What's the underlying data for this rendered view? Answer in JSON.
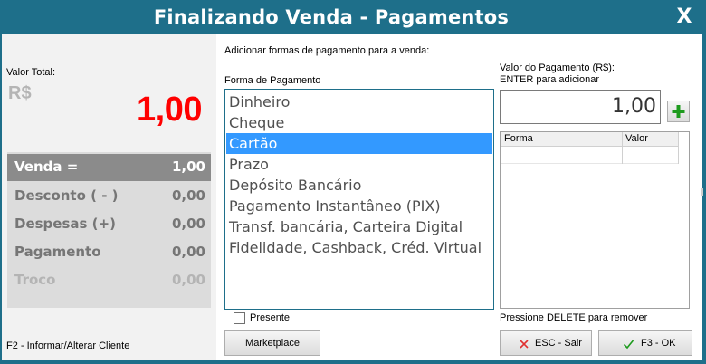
{
  "window": {
    "title": "Finalizando Venda - Pagamentos",
    "close_label": "X"
  },
  "left": {
    "valor_total_label": "Valor Total:",
    "currency": "R$",
    "total_value": "1,00",
    "summary": [
      {
        "label": "Venda =",
        "value": "1,00"
      },
      {
        "label": "Desconto ( - )",
        "value": "0,00"
      },
      {
        "label": "Despesas (+)",
        "value": "0,00"
      },
      {
        "label": "Pagamento",
        "value": "0,00"
      },
      {
        "label": "Troco",
        "value": "0,00"
      }
    ],
    "footer_hint": "F2 - Informar/Alterar Cliente"
  },
  "middle": {
    "header": "Adicionar formas de pagamento para a venda:",
    "list_label": "Forma de Pagamento",
    "payment_methods": [
      "Dinheiro",
      "Cheque",
      "Cartão",
      "Prazo",
      "Depósito Bancário",
      "Pagamento Instantâneo (PIX)",
      "Transf. bancária, Carteira Digital",
      "Fidelidade, Cashback, Créd. Virtual"
    ],
    "selected_index": 2,
    "presente_label": "Presente",
    "marketplace_label": "Marketplace"
  },
  "right": {
    "value_label_1": "Valor do Pagamento (R$):",
    "value_label_2": "ENTER para adicionar",
    "value": "1,00",
    "grid_columns": [
      "Forma",
      "Valor"
    ],
    "delete_hint": "Pressione DELETE para remover",
    "esc_label": "ESC - Sair",
    "ok_label": "F3 - OK"
  },
  "colors": {
    "frame": "#1e6f8a",
    "total_red": "#ff0000",
    "selection": "#3399ff",
    "plus_green": "#1e9b1e",
    "cancel_red": "#e03030"
  }
}
